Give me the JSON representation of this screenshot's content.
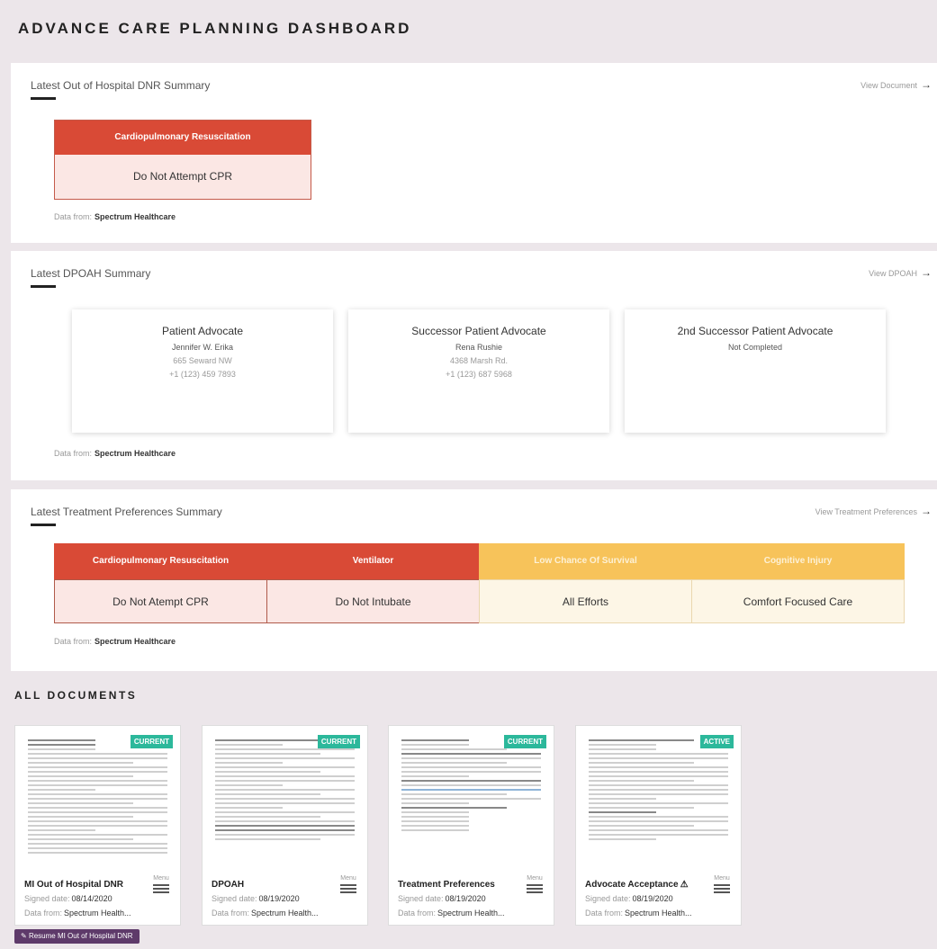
{
  "page": {
    "title": "ADVANCE CARE PLANNING DASHBOARD"
  },
  "dnr": {
    "title": "Latest Out of Hospital DNR Summary",
    "link": "View Document",
    "header": "Cardiopulmonary Resuscitation",
    "value": "Do Not Attempt CPR",
    "data_from_label": "Data from:",
    "data_from": "Spectrum Healthcare"
  },
  "dpoah": {
    "title": "Latest DPOAH Summary",
    "link": "View DPOAH",
    "advocates": [
      {
        "role": "Patient Advocate",
        "name": "Jennifer W. Erika",
        "address": "665 Seward NW",
        "phone": "+1 (123) 459 7893"
      },
      {
        "role": "Successor Patient Advocate",
        "name": "Rena Rushie",
        "address": "4368 Marsh Rd.",
        "phone": "+1 (123) 687 5968"
      },
      {
        "role": "2nd Successor Patient Advocate",
        "name": "Not Completed",
        "address": "",
        "phone": ""
      }
    ],
    "data_from_label": "Data from:",
    "data_from": "Spectrum Healthcare"
  },
  "treatment": {
    "title": "Latest Treatment Preferences Summary",
    "link": "View Treatment Preferences",
    "columns": [
      {
        "header": "Cardiopulmonary Resuscitation",
        "value": "Do Not Atempt CPR",
        "color": "#d94a36"
      },
      {
        "header": "Ventilator",
        "value": "Do Not Intubate",
        "color": "#d94a36"
      },
      {
        "header": "Low Chance Of Survival",
        "value": "All Efforts",
        "color": "#f7c35a"
      },
      {
        "header": "Cognitive Injury",
        "value": "Comfort Focused Care",
        "color": "#f7c35a"
      }
    ],
    "data_from_label": "Data from:",
    "data_from": "Spectrum Healthcare"
  },
  "documents": {
    "title": "ALL DOCUMENTS",
    "items": [
      {
        "name": "MI Out of Hospital DNR",
        "badge": "CURRENT",
        "signed_label": "Signed date:",
        "signed": "08/14/2020",
        "from_label": "Data from:",
        "from": "Spectrum Health...",
        "menu": "Menu"
      },
      {
        "name": "DPOAH",
        "badge": "CURRENT",
        "signed_label": "Signed date:",
        "signed": "08/19/2020",
        "from_label": "Data from:",
        "from": "Spectrum Health...",
        "menu": "Menu"
      },
      {
        "name": "Treatment Preferences",
        "badge": "CURRENT",
        "signed_label": "Signed date:",
        "signed": "08/19/2020",
        "from_label": "Data from:",
        "from": "Spectrum Health...",
        "menu": "Menu"
      },
      {
        "name": "Advocate Acceptance",
        "badge": "ACTIVE",
        "signed_label": "Signed date:",
        "signed": "08/19/2020",
        "from_label": "Data from:",
        "from": "Spectrum Health...",
        "menu": "Menu"
      }
    ],
    "resume_button": "Resume MI Out of Hospital DNR"
  },
  "colors": {
    "red": "#d94a36",
    "yellow": "#f7c35a",
    "badge": "#2cb89b",
    "resume": "#5e3a6a"
  }
}
